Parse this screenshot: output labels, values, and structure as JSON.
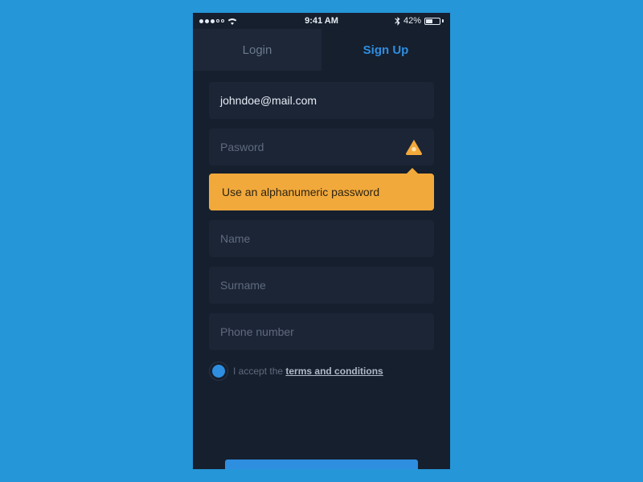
{
  "status": {
    "time": "9:41 AM",
    "battery_pct": "42%"
  },
  "tabs": {
    "login": "Login",
    "signup": "Sign Up"
  },
  "fields": {
    "email_value": "johndoe@mail.com",
    "password_placeholder": "Pasword",
    "name_placeholder": "Name",
    "surname_placeholder": "Surname",
    "phone_placeholder": "Phone number"
  },
  "tooltip": {
    "password_hint": "Use an alphanumeric password"
  },
  "terms": {
    "prefix": "I accept the ",
    "link": "terms and conditions"
  }
}
